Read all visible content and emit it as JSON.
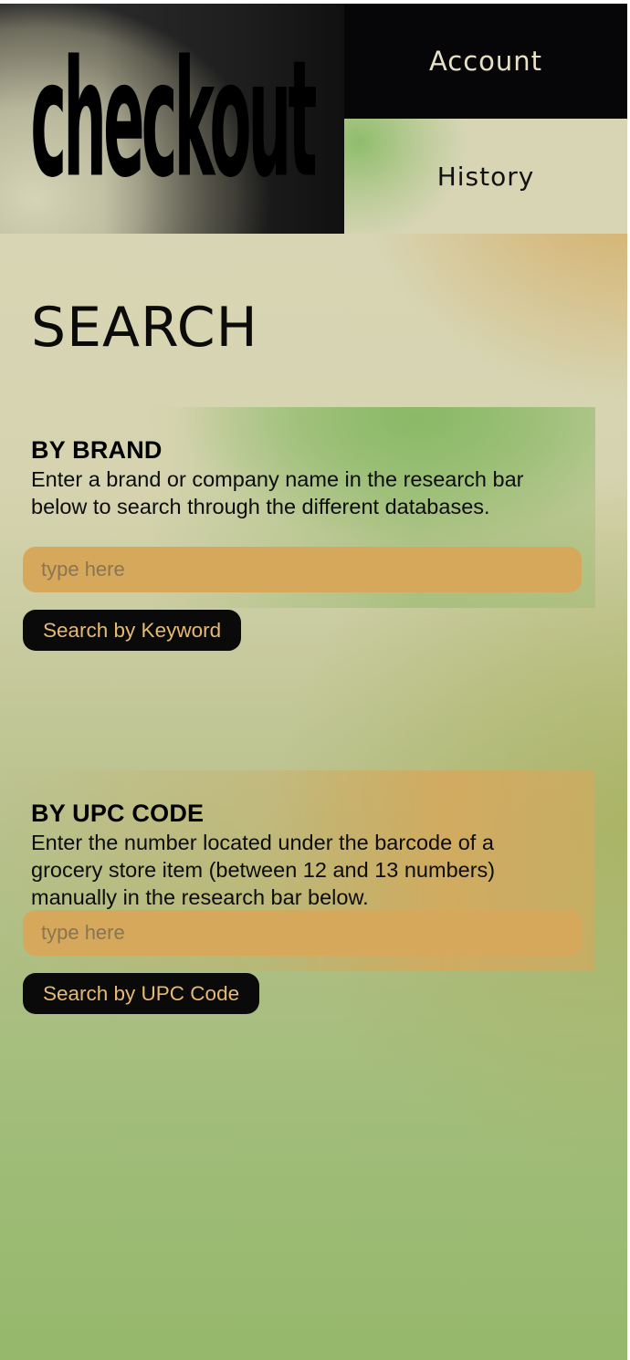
{
  "header": {
    "logo_text": "checkout",
    "nav": {
      "account_label": "Account",
      "history_label": "History"
    }
  },
  "main": {
    "title": "SEARCH",
    "by_brand": {
      "heading": "BY BRAND",
      "description": "Enter a brand or company name in the research bar below to search through the different databases.",
      "input_placeholder": "type here",
      "input_value": "",
      "button_label": "Search by Keyword"
    },
    "by_upc": {
      "heading": "BY UPC CODE",
      "description": "Enter the number located under the barcode of a grocery store item (between 12 and 13 numbers) manually in the research bar below.",
      "input_placeholder": "type here",
      "input_value": "",
      "button_label": "Search by UPC Code"
    }
  },
  "colors": {
    "input_fill": "#d6a85c",
    "button_fill": "#0a0a0a",
    "button_text": "#e6ba72",
    "nav_account_bg": "#060608",
    "nav_account_text": "#e7e1c6"
  }
}
